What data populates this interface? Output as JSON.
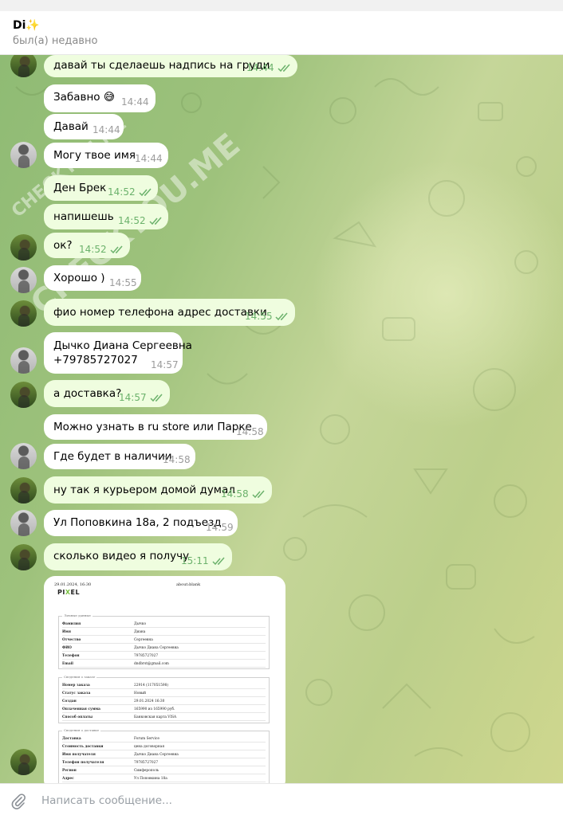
{
  "header": {
    "title": "Di✨",
    "status": "был(а) недавно"
  },
  "watermarks": [
    "CHECKYOU.ME",
    "CHECKYOU.ME"
  ],
  "messages": [
    {
      "text": "давай ты сделаешь надпись на груди",
      "time": "14:44",
      "out": true
    },
    {
      "text": "Забавно 😅",
      "time": "14:44",
      "out": false
    },
    {
      "text": "Давай",
      "time": "14:44",
      "out": false
    },
    {
      "text": "Могу твое имя",
      "time": "14:44",
      "out": false
    },
    {
      "text": "Ден Брек",
      "time": "14:52",
      "out": true
    },
    {
      "text": "напишешь",
      "time": "14:52",
      "out": true
    },
    {
      "text": "ок?",
      "time": "14:52",
      "out": true
    },
    {
      "text": "Хорошо )",
      "time": "14:55",
      "out": false
    },
    {
      "text": "фио номер телефона адрес доставки",
      "time": "14:55",
      "out": true
    },
    {
      "text": "Дычко Диана Сергеевна",
      "text2": "+79785727027",
      "time": "14:57",
      "out": false
    },
    {
      "text": "а доставка?",
      "time": "14:57",
      "out": true
    },
    {
      "text": "Можно узнать в ru store или Парке",
      "time": "14:58",
      "out": false
    },
    {
      "text": "Где будет в наличии",
      "time": "14:58",
      "out": false
    },
    {
      "text": "ну так я курьером домой думал",
      "time": "14:58",
      "out": true
    },
    {
      "text": "Ул Поповкина 18а, 2 подъезд",
      "time": "14:59",
      "out": false
    },
    {
      "text": "сколько видео я получу",
      "time": "15:11",
      "out": true
    }
  ],
  "document": {
    "header_left": "29.01.2024, 16:30",
    "header_right": "about:blank",
    "logo_a": "PI",
    "logo_x": "X",
    "logo_b": "EL",
    "sections": [
      {
        "title": "Личные данные",
        "rows": [
          {
            "k": "Фамилия",
            "v": "Дычко"
          },
          {
            "k": "Имя",
            "v": "Диана"
          },
          {
            "k": "Отчество",
            "v": "Сергеевна"
          },
          {
            "k": "ФИО",
            "v": "Дычко Диана Сергеевна"
          },
          {
            "k": "Телефон",
            "v": "79785727027"
          },
          {
            "k": "Email",
            "v": "dndbrst@gmail.com"
          }
        ]
      },
      {
        "title": "Сведения о заказе",
        "rows": [
          {
            "k": "Номер заказа",
            "v": "22914 (117051598)"
          },
          {
            "k": "Статус заказа",
            "v": "Новый"
          },
          {
            "k": "Создан",
            "v": "29.01.2024 16:30"
          },
          {
            "k": "Оплаченная сумма",
            "v": "165990 из 165990 руб."
          },
          {
            "k": "Способ оплаты",
            "v": "Банковская карта VISA"
          }
        ]
      },
      {
        "title": "Сведения о доставке",
        "rows": [
          {
            "k": "Доставка",
            "v": "Forum Service"
          },
          {
            "k": "Стоимость доставки",
            "v": "цена договорная"
          },
          {
            "k": "Имя получателя",
            "v": "Дычко Диана Сергеевна"
          },
          {
            "k": "Телефон получателя",
            "v": "79785727027"
          },
          {
            "k": "Регион",
            "v": "Симферополь"
          },
          {
            "k": "Адрес",
            "v": "Ул Поповкина 18а"
          }
        ]
      }
    ]
  },
  "composer": {
    "placeholder": "Написать сообщение..."
  },
  "colors": {
    "outgoing": "#effddf",
    "incoming": "#ffffff",
    "check": "#6cb26c"
  },
  "icons": [
    "paperclip-icon",
    "double-check-icon",
    "avatar"
  ]
}
